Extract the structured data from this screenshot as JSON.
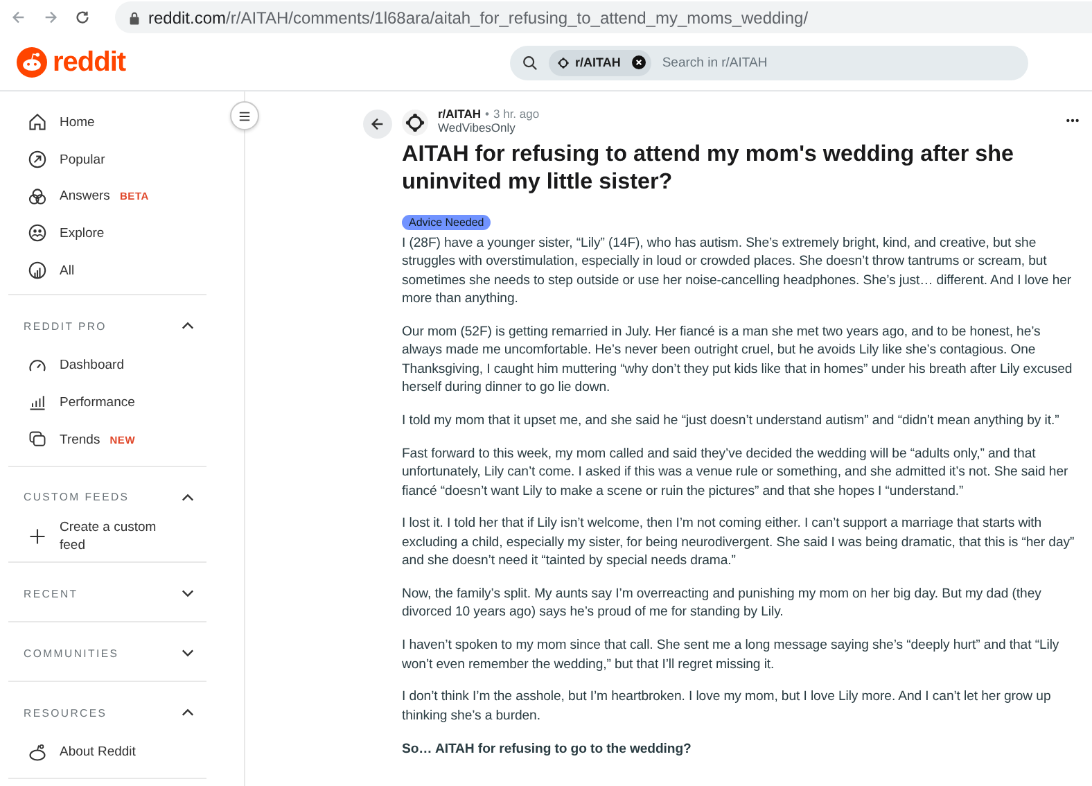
{
  "browser": {
    "url_host": "reddit.com",
    "url_path": "/r/AITAH/comments/1l68ara/aitah_for_refusing_to_attend_my_moms_wedding/"
  },
  "header": {
    "logo": "reddit",
    "search": {
      "chip": "r/AITAH",
      "placeholder": "Search in r/AITAH"
    }
  },
  "sidebar": {
    "items": [
      {
        "label": "Home"
      },
      {
        "label": "Popular"
      },
      {
        "label": "Answers",
        "badge": "BETA"
      },
      {
        "label": "Explore"
      },
      {
        "label": "All"
      }
    ],
    "sections": [
      {
        "title": "REDDIT PRO",
        "expanded": true,
        "items": [
          {
            "label": "Dashboard"
          },
          {
            "label": "Performance"
          },
          {
            "label": "Trends",
            "badge": "NEW"
          }
        ]
      },
      {
        "title": "CUSTOM FEEDS",
        "expanded": true,
        "items": [
          {
            "label": "Create a custom feed"
          }
        ]
      },
      {
        "title": "RECENT",
        "expanded": false
      },
      {
        "title": "COMMUNITIES",
        "expanded": false
      },
      {
        "title": "RESOURCES",
        "expanded": true,
        "items": [
          {
            "label": "About Reddit"
          }
        ]
      }
    ]
  },
  "post": {
    "subreddit": "r/AITAH",
    "separator": "•",
    "time": "3 hr. ago",
    "author": "WedVibesOnly",
    "title": "AITAH for refusing to attend my mom's wedding after she uninvited my little sister?",
    "flair": "Advice Needed",
    "paragraphs": [
      "I (28F) have a younger sister, “Lily” (14F), who has autism. She’s extremely bright, kind, and creative, but she struggles with overstimulation, especially in loud or crowded places. She doesn’t throw tantrums or scream, but sometimes she needs to step outside or use her noise-cancelling headphones. She’s just… different. And I love her more than anything.",
      "Our mom (52F) is getting remarried in July. Her fiancé is a man she met two years ago, and to be honest, he’s always made me uncomfortable. He’s never been outright cruel, but he avoids Lily like she’s contagious. One Thanksgiving, I caught him muttering “why don’t they put kids like that in homes” under his breath after Lily excused herself during dinner to go lie down.",
      "I told my mom that it upset me, and she said he “just doesn’t understand autism” and “didn’t mean anything by it.”",
      "Fast forward to this week, my mom called and said they’ve decided the wedding will be “adults only,” and that unfortunately, Lily can’t come. I asked if this was a venue rule or something, and she admitted it’s not. She said her fiancé “doesn’t want Lily to make a scene or ruin the pictures” and that she hopes I “understand.”",
      "I lost it. I told her that if Lily isn’t welcome, then I’m not coming either. I can’t support a marriage that starts with excluding a child, especially my sister, for being neurodivergent. She said I was being dramatic, that this is “her day” and she doesn’t need it “tainted by special needs drama.”",
      "Now, the family’s split. My aunts say I’m overreacting and punishing my mom on her big day. But my dad (they divorced 10 years ago) says he’s proud of me for standing by Lily.",
      "I haven’t spoken to my mom since that call. She sent me a long message saying she’s “deeply hurt” and that “Lily won’t even remember the wedding,” but that I’ll regret missing it.",
      "I don’t think I’m the asshole, but I’m heartbroken. I love my mom, but I love Lily more. And I can’t let her grow up thinking she’s a burden.",
      "So… AITAH for refusing to go to the wedding?"
    ],
    "bold_last": true
  }
}
